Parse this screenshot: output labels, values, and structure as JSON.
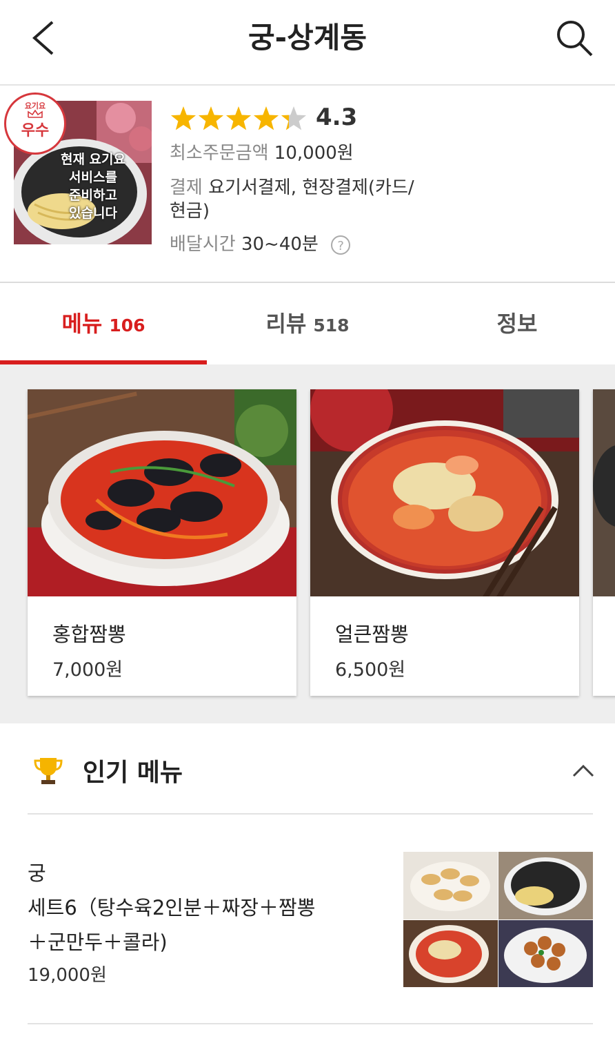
{
  "header": {
    "title": "궁-상계동",
    "back_icon": "back-icon",
    "search_icon": "search-icon"
  },
  "restaurant": {
    "badge_top": "요기요",
    "badge_main": "우수",
    "thumb_overlay": [
      "현재 요기요",
      "서비스를",
      "준비하고",
      "있습니다"
    ],
    "rating": "4.3",
    "rating_value": 4.3,
    "min_order_label": "최소주문금액",
    "min_order_value": "10,000원",
    "payment_label": "결제",
    "payment_value_line1": "요기서결제, 현장결제(카드/",
    "payment_value_line2": "현금)",
    "delivery_label": "배달시간",
    "delivery_value": "30~40분",
    "help_icon": "?"
  },
  "tabs": [
    {
      "label": "메뉴",
      "count": "106",
      "active": true
    },
    {
      "label": "리뷰",
      "count": "518",
      "active": false
    },
    {
      "label": "정보",
      "count": "",
      "active": false
    }
  ],
  "featured": [
    {
      "name": "홍합짬뽕",
      "price": "7,000원"
    },
    {
      "name": "얼큰짬뽕",
      "price": "6,500원"
    }
  ],
  "popular": {
    "title": "인기 메뉴",
    "icon": "trophy-icon",
    "items": [
      {
        "name_line1": "궁",
        "name_line2": "세트6（탕수육2인분＋짜장＋짬뽕",
        "name_line3": "＋군만두＋콜라)",
        "price": "19,000원"
      }
    ]
  },
  "colors": {
    "accent": "#d81e1e",
    "star": "#f7b500",
    "star_empty": "#cccccc",
    "badge": "#d6373c"
  }
}
